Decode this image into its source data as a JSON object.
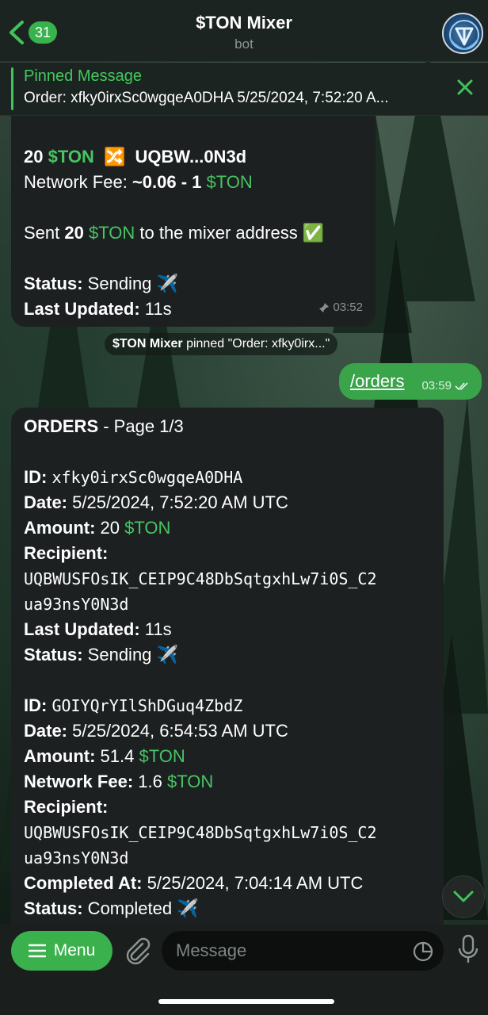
{
  "header": {
    "back_count": "31",
    "title": "$TON Mixer",
    "subtitle": "bot"
  },
  "pinned": {
    "title": "Pinned Message",
    "text": "Order: xfky0irxSc0wgqeA0DHA 5/25/2024, 7:52:20 A..."
  },
  "message1": {
    "amount": "20",
    "currency": "$TON",
    "mix_emoji": "🔀",
    "address_short": "UQBW...0N3d",
    "fee_label": "Network Fee: ",
    "fee_value": "~0.06 - 1",
    "sent_prefix": "Sent ",
    "sent_amount": "20",
    "sent_suffix": " to the mixer address ✅",
    "status_label": "Status:",
    "status_value": " Sending ✈️",
    "updated_label": "Last Updated:",
    "updated_value": " 11s",
    "time": "03:52"
  },
  "service": {
    "actor": "$TON Mixer",
    "text": " pinned \"Order: xfky0irx...\""
  },
  "outgoing": {
    "command": "/orders",
    "time": "03:59"
  },
  "orders": {
    "heading_bold": "ORDERS",
    "heading_rest": " - Page 1/3",
    "labels": {
      "id": "ID:",
      "date": "Date:",
      "amount": "Amount:",
      "fee": "Network Fee:",
      "recipient": "Recipient:",
      "updated": "Last Updated:",
      "completed": "Completed At:",
      "status": "Status:"
    },
    "currency": "$TON",
    "order1": {
      "id": "xfky0irxSc0wgqeA0DHA",
      "date": " 5/25/2024, 7:52:20 AM UTC",
      "amount": " 20",
      "recipient_line1": "UQBWUSFOsIK_CEIP9C48DbSqtgxhLw7i0S_C2",
      "recipient_line2": "ua93nsY0N3d",
      "updated": " 11s",
      "status": " Sending ✈️"
    },
    "order2": {
      "id": "GOIYQrYIlShDGuq4ZbdZ",
      "date": " 5/25/2024, 6:54:53 AM UTC",
      "amount": " 51.4",
      "fee": " 1.6",
      "recipient_line1": "UQBWUSFOsIK_CEIP9C48DbSqtgxhLw7i0S_C2",
      "recipient_line2": "ua93nsY0N3d",
      "completed": " 5/25/2024, 7:04:14 AM UTC",
      "status": " Completed ✈️"
    }
  },
  "inputbar": {
    "menu_label": "Menu",
    "placeholder": "Message"
  },
  "colors": {
    "accent": "#3bb14e",
    "ton_green": "#47c463",
    "bubble": "#1d2021",
    "header": "#1c2421"
  }
}
